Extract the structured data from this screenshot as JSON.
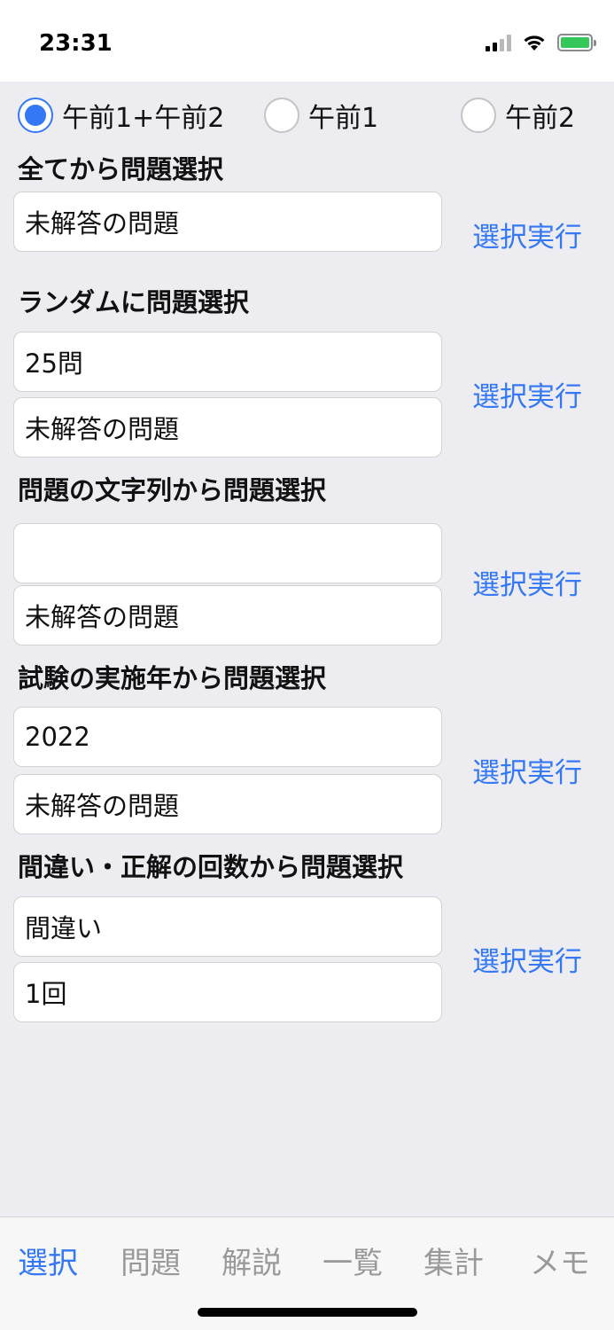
{
  "status": {
    "time": "23:31"
  },
  "scope": {
    "options": [
      "午前1+午前2",
      "午前1",
      "午前2"
    ],
    "selected": "午前1+午前2"
  },
  "sections": {
    "all": {
      "title": "全てから問題選択",
      "filter": "未解答の問題",
      "exec": "選択実行"
    },
    "random": {
      "title": "ランダムに問題選択",
      "count": "25問",
      "filter": "未解答の問題",
      "exec": "選択実行"
    },
    "text": {
      "title": "問題の文字列から問題選択",
      "query": "",
      "filter": "未解答の問題",
      "exec": "選択実行"
    },
    "year": {
      "title": "試験の実施年から問題選択",
      "year": "2022",
      "filter": "未解答の問題",
      "exec": "選択実行"
    },
    "mistakes": {
      "title": "間違い・正解の回数から問題選択",
      "kind": "間違い",
      "times": "1回",
      "exec": "選択実行"
    }
  },
  "tabs": [
    "選択",
    "問題",
    "解説",
    "一覧",
    "集計",
    "メモ"
  ],
  "active_tab": "選択",
  "colors": {
    "accent": "#3478f6",
    "background": "#ececf1"
  }
}
